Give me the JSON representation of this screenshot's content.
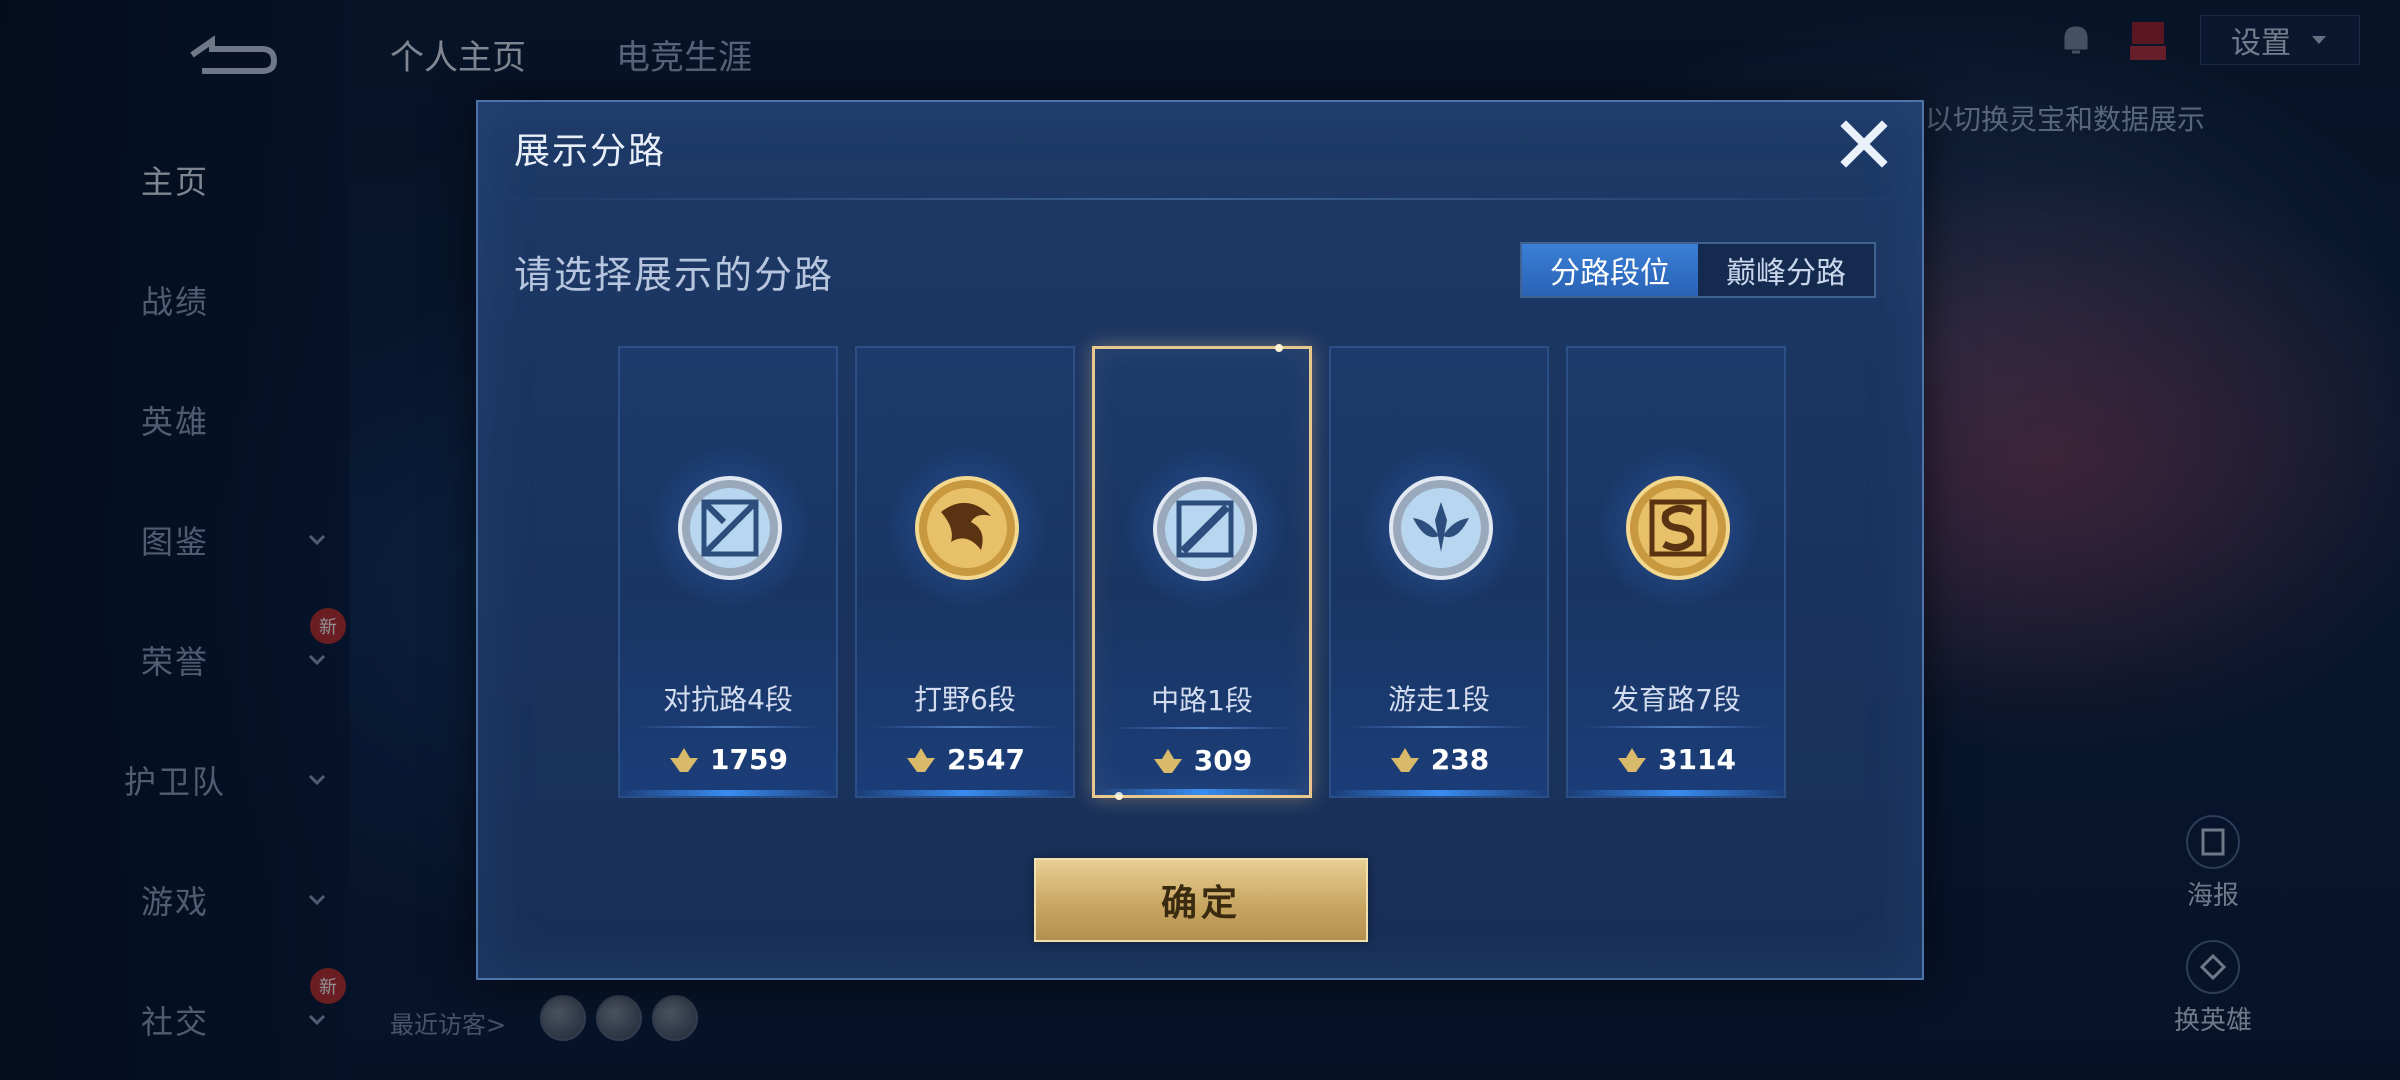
{
  "nav": {
    "top_tabs": [
      "个人主页",
      "电竞生涯"
    ],
    "settings_label": "设置",
    "sidebar": [
      "主页",
      "战绩",
      "英雄",
      "图鉴",
      "荣誉",
      "护卫队",
      "游戏",
      "社交"
    ],
    "new_badge": "新",
    "hint": "以切换灵宝和数据展示",
    "right_buttons": [
      "海报",
      "换英雄"
    ],
    "recent_visitors": "最近访客>"
  },
  "modal": {
    "title": "展示分路",
    "subtitle": "请选择展示的分路",
    "segment": [
      "分路段位",
      "巅峰分路"
    ],
    "active_segment": 0,
    "confirm_label": "确定"
  },
  "lanes": [
    {
      "rank": "对抗路4段",
      "points": "1759",
      "emblem": "clash-lane-silver-icon",
      "tier": "silver"
    },
    {
      "rank": "打野6段",
      "points": "2547",
      "emblem": "jungle-gold-icon",
      "tier": "gold"
    },
    {
      "rank": "中路1段",
      "points": "309",
      "emblem": "mid-lane-silver-icon",
      "tier": "silver"
    },
    {
      "rank": "游走1段",
      "points": "238",
      "emblem": "roam-silver-icon",
      "tier": "silver"
    },
    {
      "rank": "发育路7段",
      "points": "3114",
      "emblem": "farm-lane-gold-icon",
      "tier": "gold"
    }
  ],
  "selected_lane": 2,
  "colors": {
    "modal_bg": "#1b3460",
    "selected_border": "#e8c88c",
    "confirm_gold": "#c9a763",
    "segment_active": "#2a63b5"
  }
}
